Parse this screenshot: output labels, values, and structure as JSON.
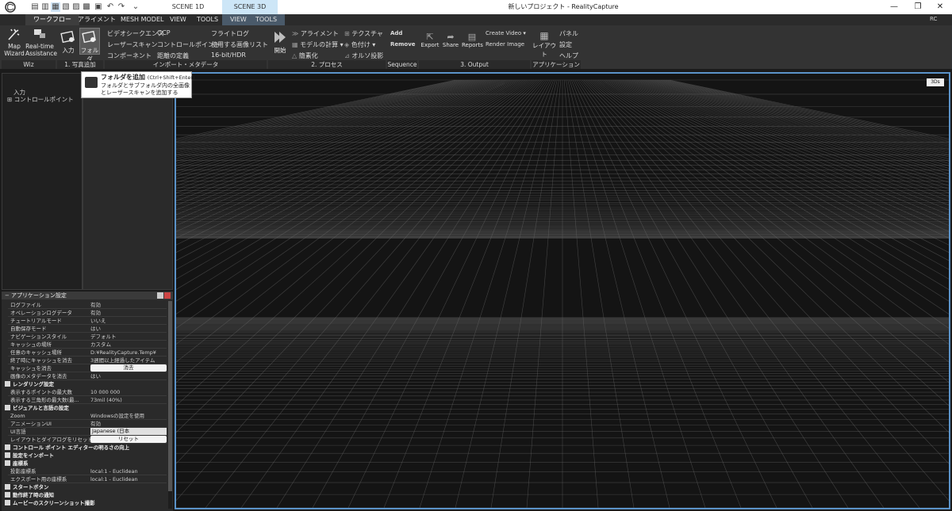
{
  "titlebar": {
    "scene_tabs": [
      "SCENE 1D",
      "SCENE 3D"
    ],
    "app_title": "新しいプロジェクト - RealityCapture",
    "window_buttons": [
      "—",
      "❐",
      "✕"
    ]
  },
  "menu": {
    "tabs": [
      "ワークフロー",
      "アライメント",
      "MESH MODEL",
      "VIEW",
      "TOOLS",
      "VIEW",
      "TOOLS"
    ],
    "user": "RC"
  },
  "ribbon": {
    "wiz": {
      "map_wizard": [
        "Map",
        "Wizard"
      ],
      "realtime": [
        "Real-time",
        "Assistance"
      ],
      "label": "Wiz"
    },
    "add_photos": {
      "input": "入力",
      "folder": "フォルダ",
      "label": "1. 写真追加"
    },
    "import_meta": {
      "col1": [
        "ビデオシークエンス",
        "レーザースキャン",
        "コンポーネント"
      ],
      "col2": [
        "GCP",
        "コントロールポイント",
        "距離の定義"
      ],
      "col3": [
        "フライトログ",
        "使用する画像リスト",
        "16-bit/HDR"
      ],
      "label": "インポート・メタデータ"
    },
    "process": {
      "start": "開始",
      "col1": [
        "アライメント",
        "モデルの計算",
        "簡素化"
      ],
      "col2": [
        "テクスチャ",
        "色付け",
        "オルソ投影"
      ],
      "label": "2. プロセス"
    },
    "sequence": {
      "items": [
        "Add",
        "Remove"
      ],
      "label": "Sequence"
    },
    "output": {
      "buttons": [
        "Export",
        "Share",
        "Reports"
      ],
      "col": [
        "Create Video",
        "Render Image"
      ],
      "label": "3. Output"
    },
    "application": {
      "layout": "レイアウト",
      "items": [
        "パネル",
        "設定",
        "ヘルプ"
      ],
      "label": "アプリケーション"
    }
  },
  "tooltip": {
    "title": "フォルダを追加",
    "shortcut": "(Ctrl+Shift+Enter)",
    "lines": [
      "フォルダとサブフォルダ内の全画像",
      "とレーザースキャンを追加する"
    ]
  },
  "tree": {
    "items": [
      "入力",
      "コントロールポイント"
    ]
  },
  "viewport": {
    "badge": "3Ds"
  },
  "settings": {
    "title": "アプリケーション設定",
    "rows1": [
      [
        "ログファイル",
        "有効"
      ],
      [
        "オペレーションログデータ",
        "有効"
      ],
      [
        "チュートリアルモード",
        "いいえ"
      ],
      [
        "自動保存モード",
        "はい"
      ],
      [
        "ナビゲーションスタイル",
        "デフォルト"
      ],
      [
        "キャッシュの場所",
        "カスタム"
      ],
      [
        "任意のキャッシュ場所",
        "D:¥RealityCapture.Temp¥"
      ],
      [
        "終了時にキャッシュを消去",
        "3週間以上経過したアイテム"
      ]
    ],
    "clear_cache": {
      "k": "キャッシュを消去",
      "btn": "消去"
    },
    "clear_meta": [
      "画像のメタデータを消去",
      "はい"
    ],
    "render_head": "レンダリング設定",
    "render_rows": [
      [
        "表示するポイントの最大数",
        "10 000 000"
      ],
      [
        "表示する三角形の最大数(最...",
        "73mil (40%)"
      ]
    ],
    "visual_head": "ビジュアルと言語の設定",
    "visual_rows": [
      [
        "Zoom",
        "Windowsの設定を使用"
      ],
      [
        "アニメーションUI",
        "有効"
      ]
    ],
    "ui_lang": {
      "k": "UI言語",
      "v": "Japanese (日本 (Nihon/Nippon))"
    },
    "reset_layout": {
      "k": "レイアウトとダイアログをリセット",
      "btn": "リセット"
    },
    "cp_head": "コントロール ポイント エディターの明るさの向上",
    "import_head": "設定をインポート",
    "coord_head": "座標系",
    "coord_rows": [
      [
        "投影座標系",
        "local:1 - Euclidean"
      ],
      [
        "エクスポート用の座標系",
        "local:1 - Euclidean"
      ]
    ],
    "tail_heads": [
      "スタートボタン",
      "動作終了時の通知",
      "ムービーのスクリーンショット撮影"
    ]
  },
  "colors": {
    "accent": "#5b93c9",
    "ribbon": "#333333",
    "panel": "#2a2a2a"
  }
}
